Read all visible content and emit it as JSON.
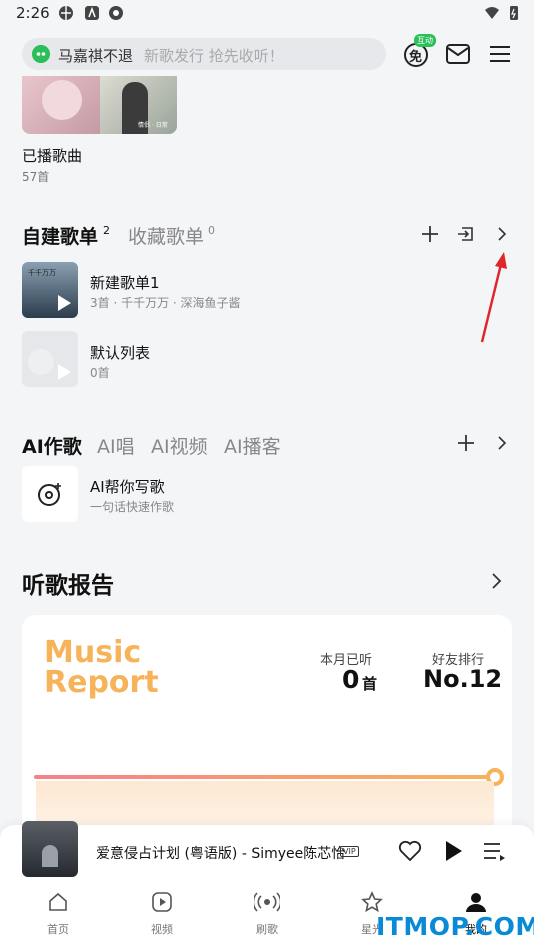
{
  "status": {
    "time": "2:26"
  },
  "search": {
    "query": "马嘉祺不退",
    "placeholder": "新歌发行 抢先收听！"
  },
  "header": {
    "badge": "互动",
    "badge_char": "免"
  },
  "recent": {
    "title": "已播歌曲",
    "count": "57首",
    "cover_text": "情侣 · 日常"
  },
  "playlists": {
    "tab_own": "自建歌单",
    "tab_own_count": "2",
    "tab_fav": "收藏歌单",
    "tab_fav_count": "0",
    "items": [
      {
        "title": "新建歌单1",
        "sub": "3首 · 千千万万 · 深海鱼子酱",
        "cover_text": "千千万万"
      },
      {
        "title": "默认列表",
        "sub": "0首"
      }
    ]
  },
  "ai": {
    "tabs": [
      "AI作歌",
      "AI唱",
      "AI视频",
      "AI播客"
    ],
    "item_title": "AI帮你写歌",
    "item_sub": "一句话快速作歌"
  },
  "report": {
    "heading": "听歌报告",
    "music": "Music",
    "report": "Report",
    "month_label": "本月已听",
    "month_value": "0",
    "month_unit": "首",
    "rank_label": "好友排行",
    "rank_value": "No.12"
  },
  "player": {
    "song": "爱意侵占计划 (粤语版) - Simyee陈芯怡",
    "vip": "VIP"
  },
  "nav": [
    {
      "label": "首页",
      "icon": "home-icon"
    },
    {
      "label": "视频",
      "icon": "video-icon"
    },
    {
      "label": "刷歌",
      "icon": "radio-icon"
    },
    {
      "label": "星光",
      "icon": "star-icon"
    },
    {
      "label": "我的",
      "icon": "profile-icon"
    }
  ],
  "watermark": "ITMOP.COM",
  "colors": {
    "accent_green": "#2bbf5a",
    "report_orange": "#f6b35a",
    "progress_pink": "#f7808a",
    "annotation_red": "#e0262a"
  }
}
